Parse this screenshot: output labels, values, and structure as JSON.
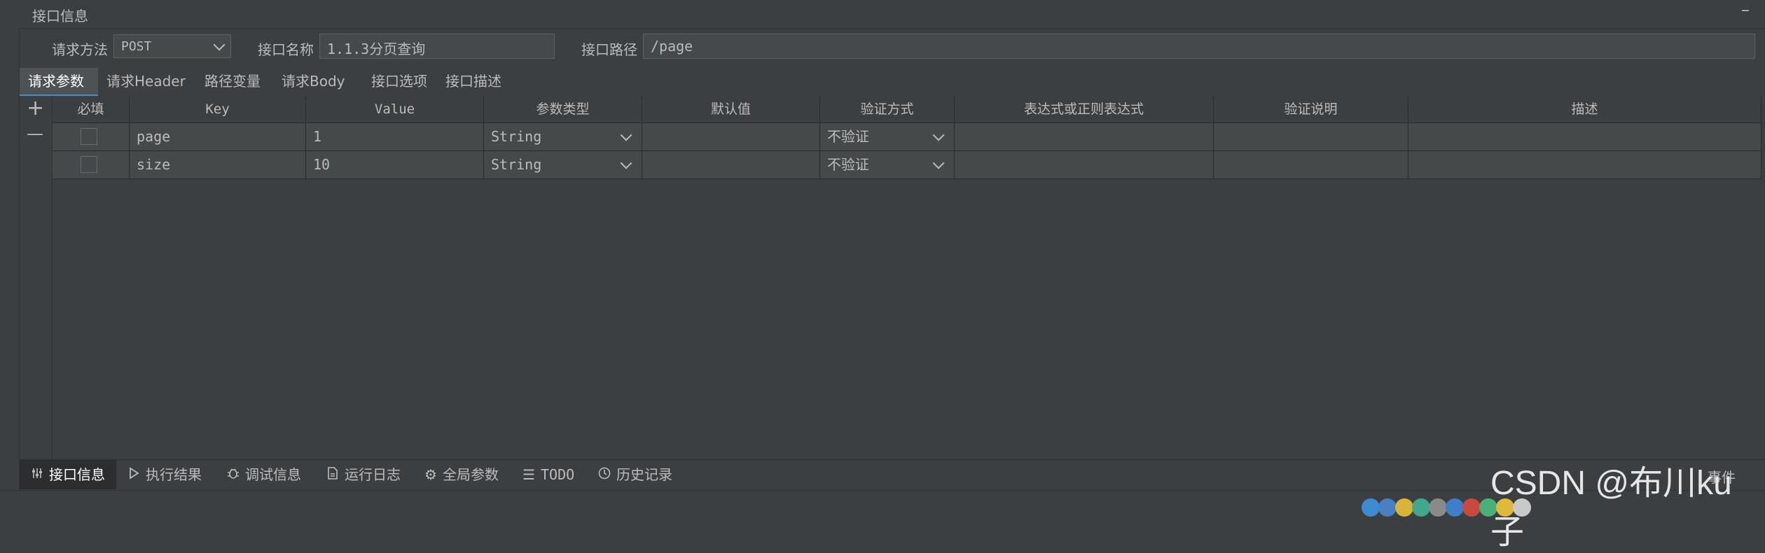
{
  "panel": {
    "title": "接口信息",
    "minimize": "–"
  },
  "form": {
    "method_label": "请求方法",
    "method_value": "POST",
    "name_label": "接口名称",
    "name_value": "1.1.3分页查询",
    "path_label": "接口路径",
    "path_value": "/page"
  },
  "tabs": [
    "请求参数",
    "请求Header",
    "路径变量",
    "请求Body",
    "接口选项",
    "接口描述"
  ],
  "controls": {
    "add": "+",
    "remove": "—"
  },
  "table": {
    "columns": [
      "必填",
      "Key",
      "Value",
      "参数类型",
      "默认值",
      "验证方式",
      "表达式或正则表达式",
      "验证说明",
      "描述"
    ],
    "rows": [
      {
        "required": false,
        "key": "page",
        "value": "1",
        "type": "String",
        "default": "",
        "validation": "不验证",
        "expr": "",
        "validation_desc": "",
        "desc": ""
      },
      {
        "required": false,
        "key": "size",
        "value": "10",
        "type": "String",
        "default": "",
        "validation": "不验证",
        "expr": "",
        "validation_desc": "",
        "desc": ""
      }
    ]
  },
  "bottom_tabs": [
    {
      "label": "接口信息",
      "icon": "sliders-icon"
    },
    {
      "label": "执行结果",
      "icon": "play-icon"
    },
    {
      "label": "调试信息",
      "icon": "bug-icon"
    },
    {
      "label": "运行日志",
      "icon": "log-icon"
    },
    {
      "label": "全局参数",
      "icon": "gear-icon"
    },
    {
      "label": "TODO",
      "icon": "list-icon"
    },
    {
      "label": "历史记录",
      "icon": "clock-icon"
    }
  ],
  "right_bottom": "事件",
  "watermark": "CSDN @布川ku子",
  "colors": {
    "background": "#3c3f41",
    "cell": "#45494a",
    "accent": "#4a88c7",
    "text": "#bbbbbb"
  }
}
